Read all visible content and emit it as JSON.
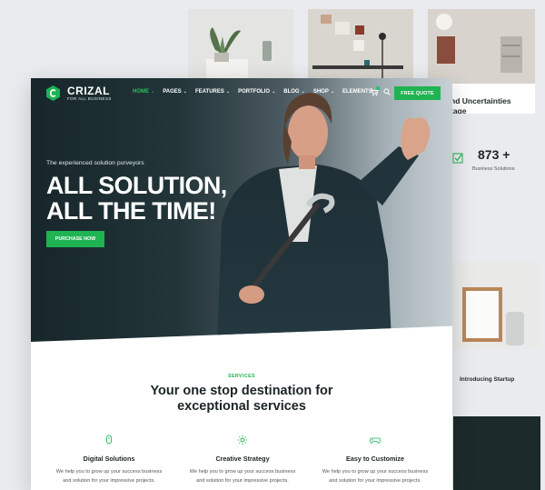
{
  "background": {
    "card3_caption": "nd Uncertainties\ntage",
    "stat_number": "873 +",
    "stat_label": "Business Solutions",
    "card4_caption": "Introducing Startup"
  },
  "nav": {
    "logo_name": "CRIZAL",
    "logo_tagline": "FOR ALL BUSINESS",
    "items": [
      {
        "label": "HOME",
        "active": true,
        "chevron": true
      },
      {
        "label": "PAGES",
        "active": false,
        "chevron": true
      },
      {
        "label": "FEATURES",
        "active": false,
        "chevron": true
      },
      {
        "label": "PORTFOLIO",
        "active": false,
        "chevron": true
      },
      {
        "label": "BLOG",
        "active": false,
        "chevron": true
      },
      {
        "label": "SHOP",
        "active": false,
        "chevron": true
      },
      {
        "label": "ELEMENTS",
        "active": false,
        "chevron": true
      }
    ],
    "chevron_glyph": "⌄",
    "quote_button": "FREE QUOTE"
  },
  "hero": {
    "subtitle": "The experienced solution purveyors",
    "title_line1": "ALL SOLUTION,",
    "title_line2": "ALL THE TIME!",
    "cta": "PURCHASE NOW"
  },
  "services": {
    "kicker": "SERVICES",
    "title_line1": "Your one stop destination for",
    "title_line2": "exceptional services",
    "items": [
      {
        "icon": "mouse-icon",
        "name": "Digital Solutions",
        "desc": "We help you to grow up your success business and solution for your impressive projects."
      },
      {
        "icon": "sun-icon",
        "name": "Creative Strategy",
        "desc": "We help you to grow up your success business and solution for your impressive projects."
      },
      {
        "icon": "gamepad-icon",
        "name": "Easy to Customize",
        "desc": "We help you to grow up your success business and solution for your impressive projects."
      }
    ]
  },
  "colors": {
    "accent": "#1fb352",
    "dark": "#17262a"
  }
}
